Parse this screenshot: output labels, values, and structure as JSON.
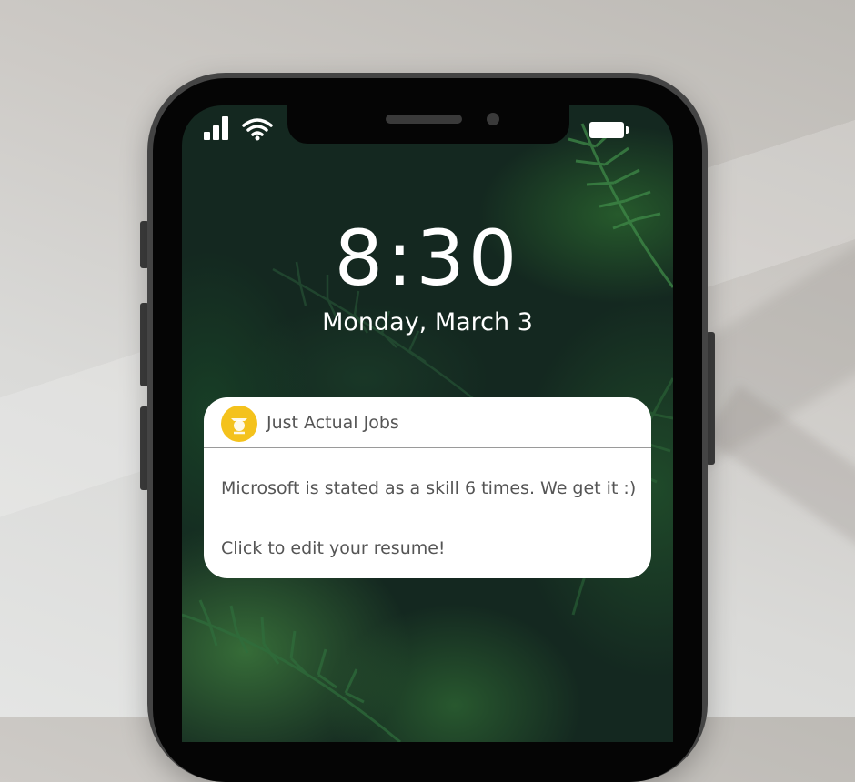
{
  "status_bar": {
    "signal_icon": "cellular-signal-icon",
    "wifi_icon": "wifi-icon",
    "battery_icon": "battery-icon"
  },
  "lock_screen": {
    "time": "8:30",
    "date": "Monday, March 3"
  },
  "notification": {
    "app_icon": "app-logo-icon",
    "app_name": "Just Actual Jobs",
    "message": "Microsoft is stated as a skill 6 times. We get it :)",
    "call_to_action": "Click to edit your resume!"
  },
  "colors": {
    "app_icon_bg": "#f4c21c",
    "notification_bg": "#ffffff",
    "notification_text": "#555555"
  }
}
